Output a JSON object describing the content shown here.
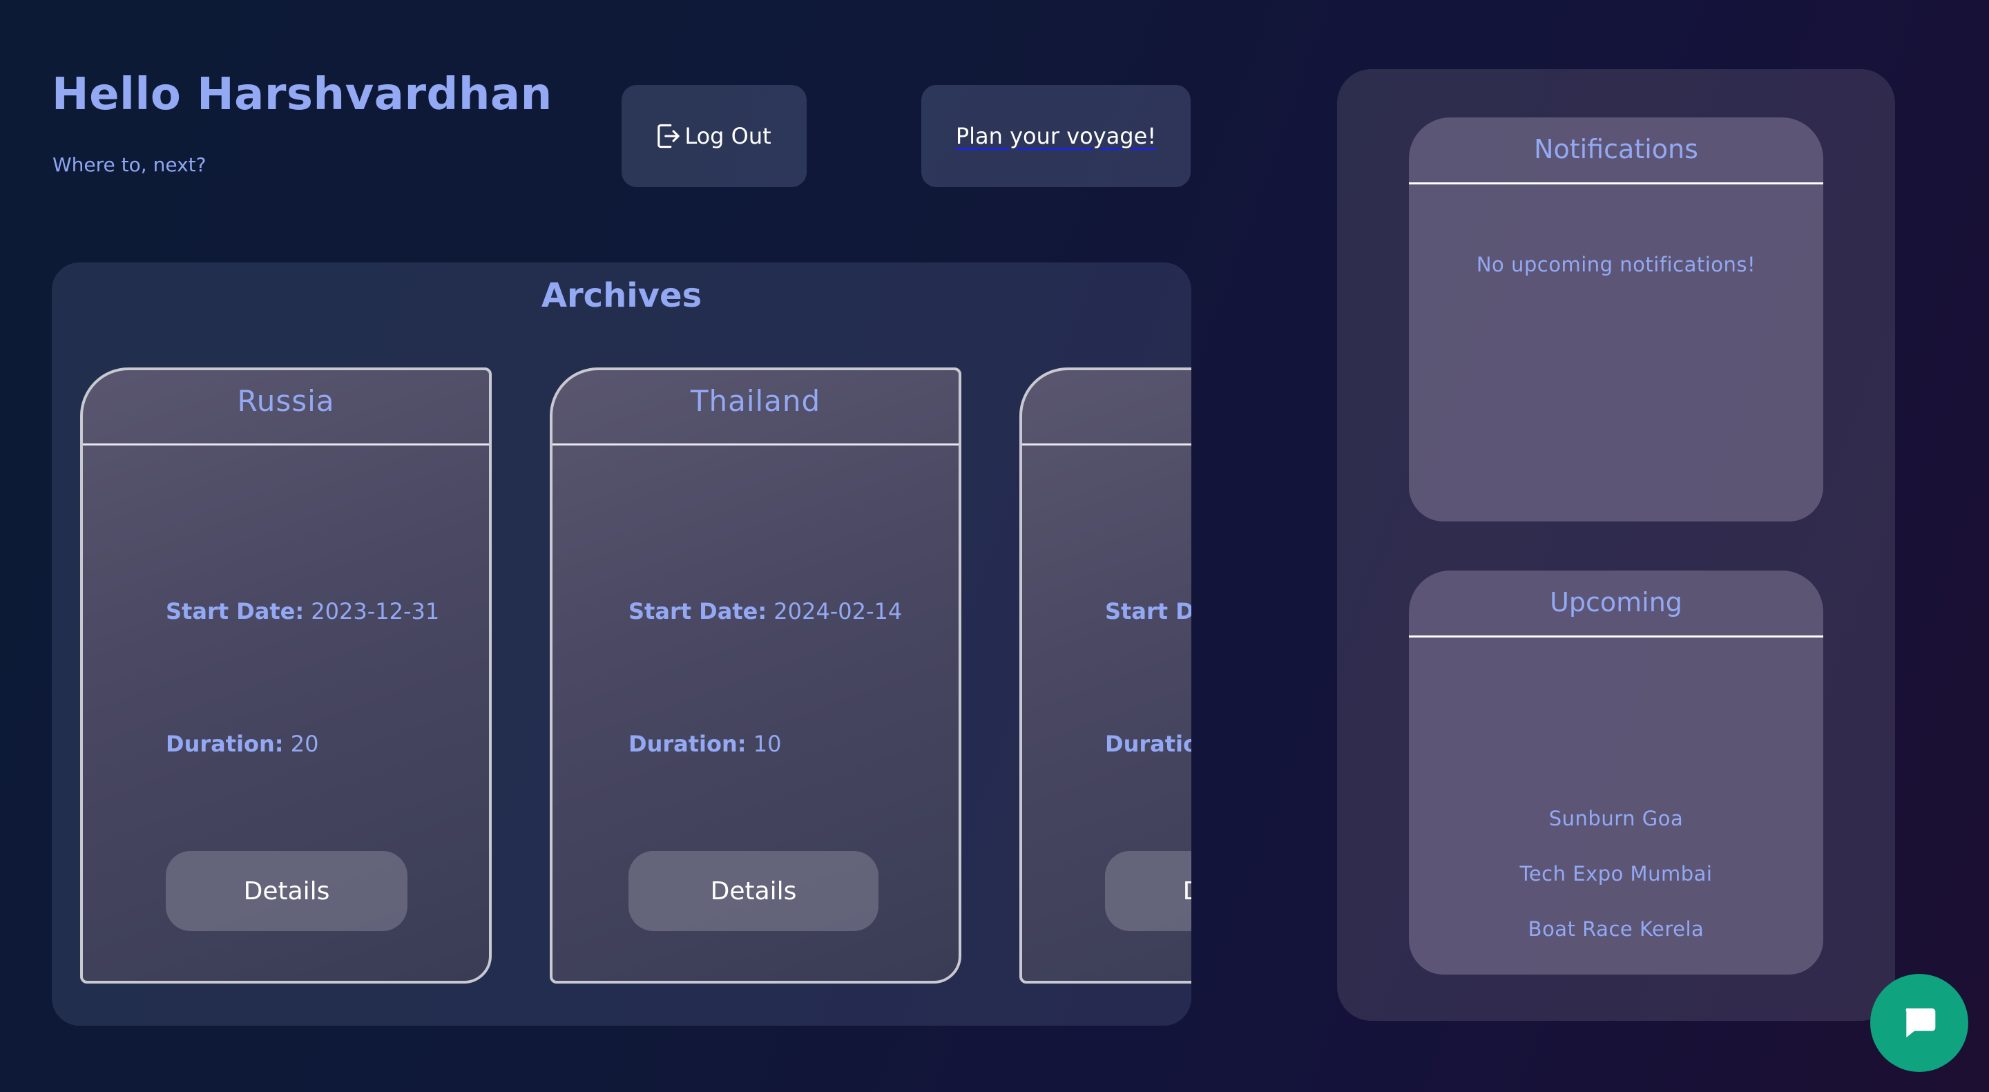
{
  "header": {
    "greeting": "Hello Harshvardhan",
    "subtitle": "Where to, next?",
    "logout_label": "Log Out",
    "plan_label": "Plan your voyage!"
  },
  "archives": {
    "title": "Archives",
    "cards": [
      {
        "country": "Russia",
        "start_label": "Start Date:",
        "start_date": "2023-12-31",
        "duration_label": "Duration:",
        "duration": "20",
        "details_label": "Details"
      },
      {
        "country": "Thailand",
        "start_label": "Start Date:",
        "start_date": "2024-02-14",
        "duration_label": "Duration:",
        "duration": "10",
        "details_label": "Details"
      },
      {
        "country": "",
        "start_label": "Start Date:",
        "start_date": "",
        "duration_label": "Duration:",
        "duration": "",
        "details_label": "Details"
      }
    ]
  },
  "notifications": {
    "title": "Notifications",
    "empty_text": "No upcoming notifications!"
  },
  "upcoming": {
    "title": "Upcoming",
    "events": [
      "Sunburn Goa",
      "Tech Expo Mumbai",
      "Boat Race Kerela"
    ]
  },
  "icons": {
    "logout": "logout-icon",
    "chat": "chat-bubble-icon"
  },
  "colors": {
    "accent": "#93a9f4",
    "chat_button": "#10a37f"
  }
}
